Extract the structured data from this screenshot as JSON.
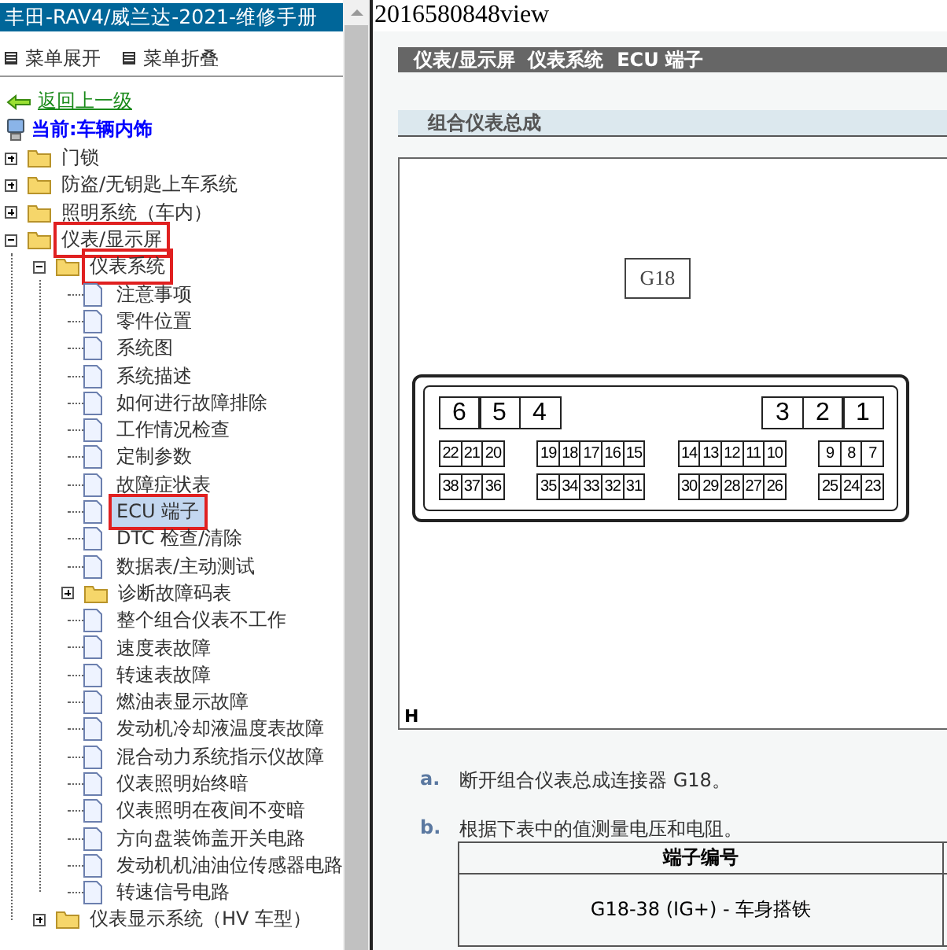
{
  "sidebar": {
    "title": "丰田-RAV4/威兰达-2021-维修手册",
    "menu_actions": [
      "菜单展开",
      "菜单折叠"
    ],
    "back_link": "返回上一级",
    "current": "当前:车辆内饰",
    "tree": [
      {
        "label": "门锁",
        "kind": "folder",
        "expanded": false,
        "boxed": false,
        "selected": false
      },
      {
        "label": "防盗/无钥匙上车系统",
        "kind": "folder",
        "expanded": false,
        "boxed": false,
        "selected": false
      },
      {
        "label": "照明系统（车内）",
        "kind": "folder",
        "expanded": false,
        "boxed": false,
        "selected": false
      },
      {
        "label": "仪表/显示屏",
        "kind": "folder",
        "expanded": true,
        "boxed": true,
        "selected": false,
        "children": [
          {
            "label": "仪表系统",
            "kind": "folder",
            "expanded": true,
            "boxed": true,
            "selected": false,
            "children": [
              {
                "label": "注意事项",
                "kind": "page",
                "boxed": false,
                "selected": false
              },
              {
                "label": "零件位置",
                "kind": "page",
                "boxed": false,
                "selected": false
              },
              {
                "label": "系统图",
                "kind": "page",
                "boxed": false,
                "selected": false
              },
              {
                "label": "系统描述",
                "kind": "page",
                "boxed": false,
                "selected": false
              },
              {
                "label": "如何进行故障排除",
                "kind": "page",
                "boxed": false,
                "selected": false
              },
              {
                "label": "工作情况检查",
                "kind": "page",
                "boxed": false,
                "selected": false
              },
              {
                "label": "定制参数",
                "kind": "page",
                "boxed": false,
                "selected": false
              },
              {
                "label": "故障症状表",
                "kind": "page",
                "boxed": false,
                "selected": false
              },
              {
                "label": "ECU 端子",
                "kind": "page",
                "boxed": true,
                "selected": true
              },
              {
                "label": "DTC 检查/清除",
                "kind": "page",
                "boxed": false,
                "selected": false
              },
              {
                "label": "数据表/主动测试",
                "kind": "page",
                "boxed": false,
                "selected": false
              },
              {
                "label": "诊断故障码表",
                "kind": "folder",
                "expanded": false,
                "boxed": false,
                "selected": false
              },
              {
                "label": "整个组合仪表不工作",
                "kind": "page",
                "boxed": false,
                "selected": false
              },
              {
                "label": "速度表故障",
                "kind": "page",
                "boxed": false,
                "selected": false
              },
              {
                "label": "转速表故障",
                "kind": "page",
                "boxed": false,
                "selected": false
              },
              {
                "label": "燃油表显示故障",
                "kind": "page",
                "boxed": false,
                "selected": false
              },
              {
                "label": "发动机冷却液温度表故障",
                "kind": "page",
                "boxed": false,
                "selected": false
              },
              {
                "label": "混合动力系统指示仪故障",
                "kind": "page",
                "boxed": false,
                "selected": false
              },
              {
                "label": "仪表照明始终暗",
                "kind": "page",
                "boxed": false,
                "selected": false
              },
              {
                "label": "仪表照明在夜间不变暗",
                "kind": "page",
                "boxed": false,
                "selected": false
              },
              {
                "label": "方向盘装饰盖开关电路",
                "kind": "page",
                "boxed": false,
                "selected": false
              },
              {
                "label": "发动机机油油位传感器电路",
                "kind": "page",
                "boxed": false,
                "selected": false
              },
              {
                "label": "转速信号电路",
                "kind": "page",
                "boxed": false,
                "selected": false
              }
            ]
          },
          {
            "label": "仪表显示系统（HV 车型）",
            "kind": "folder",
            "expanded": false,
            "boxed": false,
            "selected": false
          }
        ]
      }
    ]
  },
  "document": {
    "title": "2016580848view",
    "breadcrumb": "仪表/显示屏  仪表系统  ECU 端子",
    "section": "组合仪表总成",
    "figure": {
      "connector_label": "G18",
      "large_pins": [
        [
          "6",
          "5",
          "4"
        ],
        [
          "3",
          "2",
          "1"
        ]
      ],
      "pin_rows": [
        [
          [
            "22",
            "21",
            "20"
          ],
          [
            "19",
            "18",
            "17",
            "16",
            "15"
          ],
          [
            "14",
            "13",
            "12",
            "11",
            "10"
          ],
          [
            "9",
            "8",
            "7"
          ]
        ],
        [
          [
            "38",
            "37",
            "36"
          ],
          [
            "35",
            "34",
            "33",
            "32",
            "31"
          ],
          [
            "30",
            "29",
            "28",
            "27",
            "26"
          ],
          [
            "25",
            "24",
            "23"
          ]
        ]
      ],
      "corner_label": "H"
    },
    "steps": [
      {
        "marker": "a.",
        "text": "断开组合仪表总成连接器 G18。"
      },
      {
        "marker": "b.",
        "text": "根据下表中的值测量电压和电阻。"
      }
    ],
    "table": {
      "columns": [
        "端子编号"
      ],
      "rows": [
        [
          "G18-38 (IG+) - 车身搭铁"
        ]
      ]
    }
  }
}
